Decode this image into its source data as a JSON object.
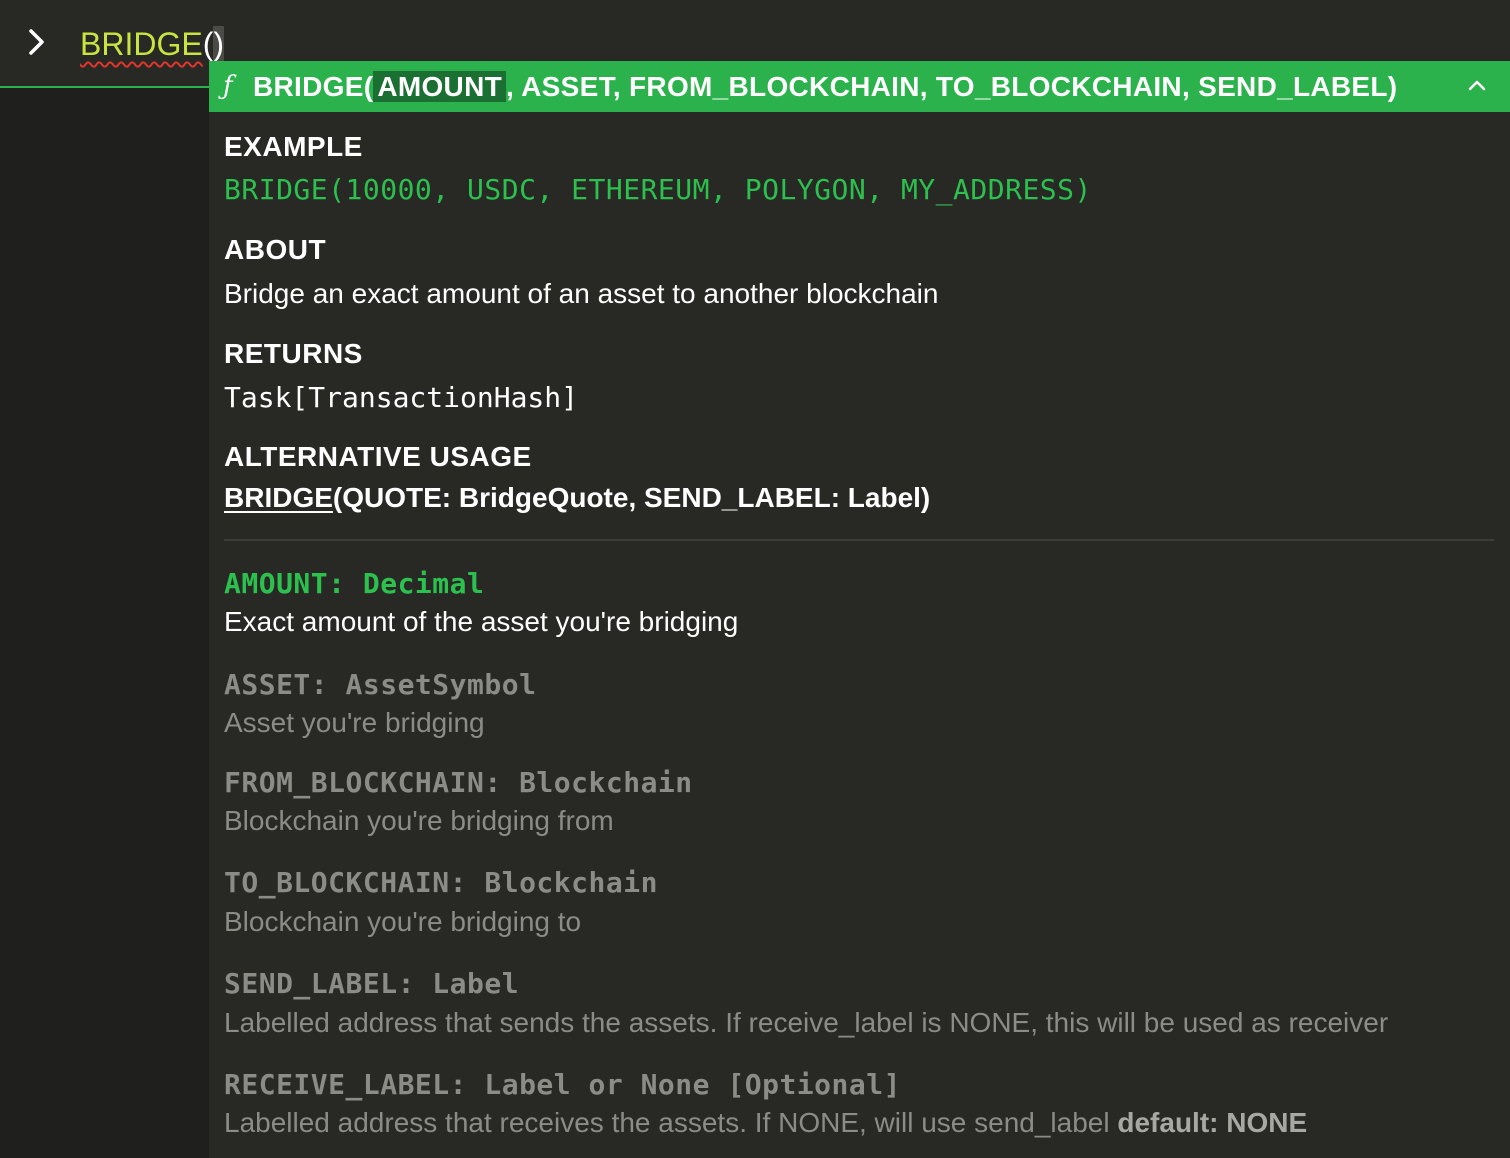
{
  "input": {
    "function_name": "BRIDGE",
    "open_paren": "(",
    "close_paren": ")"
  },
  "signature": {
    "fn_symbol": "ƒ",
    "prefix": "BRIDGE(",
    "active_param": "AMOUNT",
    "rest": ", ASSET, FROM_BLOCKCHAIN, TO_BLOCKCHAIN, SEND_LABEL)"
  },
  "example": {
    "heading": "EXAMPLE",
    "code": "BRIDGE(10000, USDC, ETHEREUM, POLYGON, MY_ADDRESS)"
  },
  "about": {
    "heading": "ABOUT",
    "text": "Bridge an exact amount of an asset to another blockchain"
  },
  "returns": {
    "heading": "RETURNS",
    "type": "Task[TransactionHash]"
  },
  "alternative_usage": {
    "heading": "ALTERNATIVE USAGE",
    "fn": "BRIDGE",
    "args": "(QUOTE: BridgeQuote, SEND_LABEL: Label)"
  },
  "params": [
    {
      "name": "AMOUNT: Decimal",
      "desc": "Exact amount of the asset you're bridging",
      "active": true
    },
    {
      "name": "ASSET: AssetSymbol",
      "desc": "Asset you're bridging",
      "active": false
    },
    {
      "name": "FROM_BLOCKCHAIN: Blockchain",
      "desc": "Blockchain you're bridging from",
      "active": false
    },
    {
      "name": "TO_BLOCKCHAIN: Blockchain",
      "desc": "Blockchain you're bridging to",
      "active": false
    },
    {
      "name": "SEND_LABEL: Label",
      "desc": "Labelled address that sends the assets. If receive_label is NONE, this will be used as receiver",
      "active": false
    },
    {
      "name": "RECEIVE_LABEL: Label or None [Optional]",
      "desc": "Labelled address that receives the assets. If NONE, will use send_label ",
      "default_note": "default: NONE",
      "active": false
    }
  ],
  "colors": {
    "accent_green": "#2bb24c",
    "code_green": "#2cc04f",
    "function_yellow_green": "#c8e53f",
    "error_squiggle": "#e0352b",
    "background": "#282824"
  },
  "icons": {
    "prompt": "chevron-right-icon",
    "collapse": "chevron-up-icon",
    "function": "function-icon"
  }
}
